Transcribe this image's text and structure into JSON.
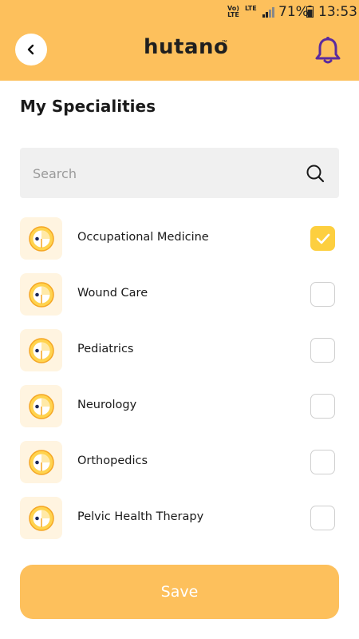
{
  "status_bar": {
    "volte": "Vo)\nLTE",
    "lte": "LTE",
    "battery_percent": "71%",
    "time": "13:53"
  },
  "header": {
    "logo_text": "hutano",
    "logo_tm": "™",
    "back_icon": "chevron-left-icon",
    "notification_icon": "bell-icon",
    "background_color": "#FDC05C",
    "bell_color": "#5B2B9E"
  },
  "page": {
    "title": "My Specialities"
  },
  "search": {
    "placeholder": "Search",
    "value": ""
  },
  "specialities": [
    {
      "label": "Occupational Medicine",
      "checked": true
    },
    {
      "label": "Wound Care",
      "checked": false
    },
    {
      "label": "Pediatrics",
      "checked": false
    },
    {
      "label": "Neurology",
      "checked": false
    },
    {
      "label": "Orthopedics",
      "checked": false
    },
    {
      "label": "Pelvic Health Therapy",
      "checked": false
    }
  ],
  "footer": {
    "save_label": "Save"
  }
}
